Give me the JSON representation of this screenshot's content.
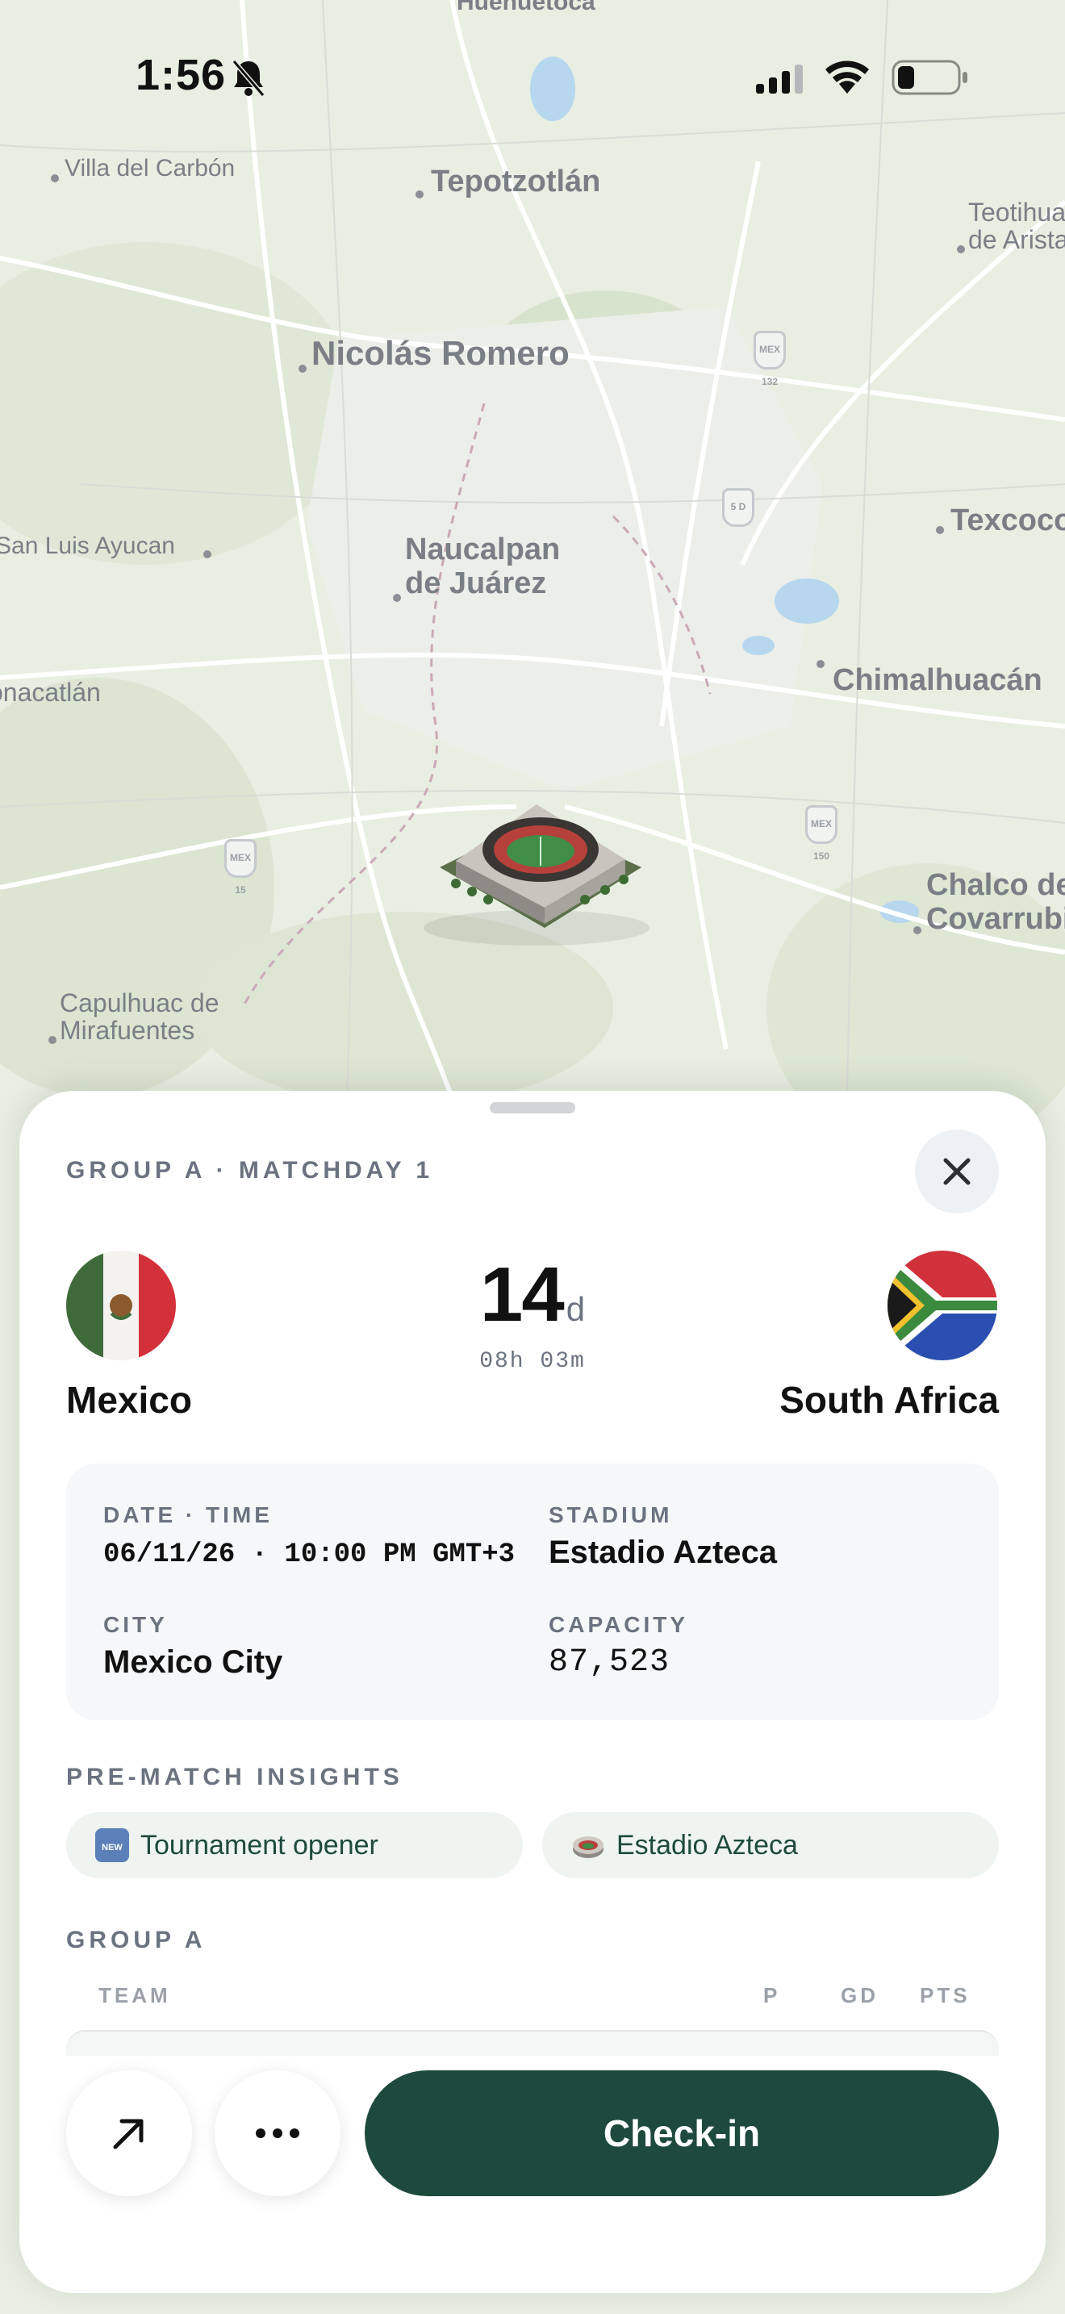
{
  "status_bar": {
    "time": "1:56"
  },
  "map": {
    "places": [
      "Huehuetoca",
      "Villa del Carbón",
      "Tepotzotlán",
      "Teotihuacán de Arista",
      "Nicolás Romero",
      "San Luis Ayucan",
      "Naucalpan de Juárez",
      "Texcoco",
      "Chimalhuacán",
      "Jonacatlán",
      "Capulhuac de Mirafuentes",
      "Chalco de Covarrubias"
    ],
    "shields": [
      "MEX 132",
      "5 D",
      "MEX 15",
      "MEX 150"
    ]
  },
  "match": {
    "group_label": "GROUP A · MATCHDAY 1",
    "home_team": "Mexico",
    "away_team": "South Africa",
    "countdown_days": "14",
    "countdown_unit": "d",
    "countdown_rest": "08h 03m"
  },
  "info": {
    "date_label": "DATE · TIME",
    "date_value": "06/11/26 · 10:00 PM GMT+3",
    "stadium_label": "STADIUM",
    "stadium_value": "Estadio Azteca",
    "city_label": "CITY",
    "city_value": "Mexico City",
    "capacity_label": "CAPACITY",
    "capacity_value": "87,523"
  },
  "insights": {
    "title": "PRE-MATCH INSIGHTS",
    "chips": [
      {
        "icon": "new-badge-icon",
        "label": "Tournament opener"
      },
      {
        "icon": "stadium-icon",
        "label": "Estadio Azteca"
      }
    ]
  },
  "standings": {
    "title": "GROUP A",
    "columns": [
      "TEAM",
      "P",
      "GD",
      "PTS"
    ]
  },
  "actions": {
    "checkin_label": "Check-in"
  },
  "colors": {
    "accent": "#1e4a3e",
    "chip_bg": "#eff4f1"
  }
}
